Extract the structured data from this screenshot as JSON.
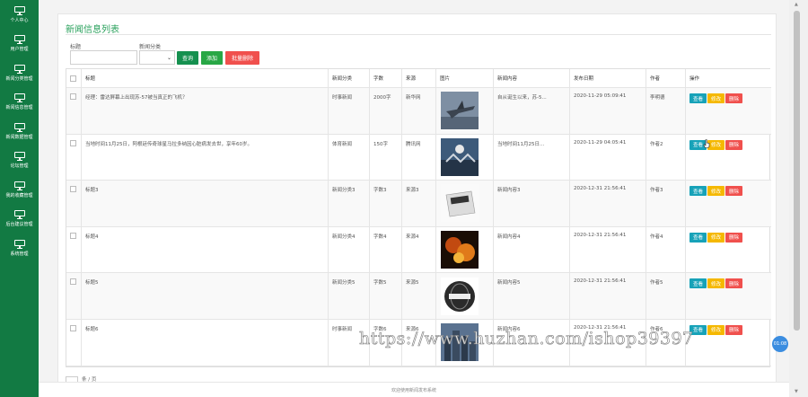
{
  "sidebar": {
    "items": [
      {
        "label": "个人中心",
        "icon": "monitor-icon"
      },
      {
        "label": "用户管理",
        "icon": "monitor-icon"
      },
      {
        "label": "新闻分类管理",
        "icon": "monitor-icon"
      },
      {
        "label": "新闻信息管理",
        "icon": "monitor-icon"
      },
      {
        "label": "新闻数据管理",
        "icon": "monitor-icon"
      },
      {
        "label": "论坛管理",
        "icon": "monitor-icon"
      },
      {
        "label": "我的收藏管理",
        "icon": "monitor-icon"
      },
      {
        "label": "后台建议管理",
        "icon": "monitor-icon"
      },
      {
        "label": "系统管理",
        "icon": "monitor-icon"
      }
    ]
  },
  "panel": {
    "title": "新闻信息列表"
  },
  "filters": {
    "title_label": "标题",
    "title_value": "",
    "category_label": "新闻分类",
    "category_value": "",
    "search_button": "查询",
    "add_button": "添加",
    "batch_delete_button": "批量删除"
  },
  "table": {
    "headers": [
      "",
      "标题",
      "新闻分类",
      "字数",
      "来源",
      "图片",
      "新闻内容",
      "发布日期",
      "作者",
      "操作"
    ],
    "rows": [
      {
        "title": "经理：雷达屏幕上出现苏-57被当真正的飞机？",
        "category": "时事新闻",
        "words": "2000字",
        "source": "新华网",
        "image": "fighter-jet",
        "content": "自从诞生以来，苏-5...",
        "date": "2020-11-29 05:09:41",
        "author": "李明德"
      },
      {
        "title": "当地时间11月25日，阿根廷传奇球星马拉多纳因心脏病发去世，享年60岁。",
        "category": "体育新闻",
        "words": "150字",
        "source": "腾讯网",
        "image": "stadium-crowd",
        "content": "当地时间11月25日...",
        "date": "2020-11-29 04:05:41",
        "author": "作者2"
      },
      {
        "title": "标题3",
        "category": "新闻分类3",
        "words": "字数3",
        "source": "来源3",
        "image": "news-paper",
        "content": "新闻内容3",
        "date": "2020-12-31 21:56:41",
        "author": "作者3"
      },
      {
        "title": "标题4",
        "category": "新闻分类4",
        "words": "字数4",
        "source": "来源4",
        "image": "fire-news",
        "content": "新闻内容4",
        "date": "2020-12-31 21:56:41",
        "author": "作者4"
      },
      {
        "title": "标题5",
        "category": "新闻分类5",
        "words": "字数5",
        "source": "来源5",
        "image": "news-globe",
        "content": "新闻内容5",
        "date": "2020-12-31 21:56:41",
        "author": "作者5"
      },
      {
        "title": "标题6",
        "category": "时事新闻",
        "words": "字数6",
        "source": "来源6",
        "image": "city-skyline",
        "content": "新闻内容6",
        "date": "2020-12-31 21:56:41",
        "author": "作者6"
      }
    ],
    "actions": {
      "view": "查看",
      "edit": "修改",
      "delete": "删除"
    }
  },
  "pager": {
    "text": "条 / 页"
  },
  "footer": {
    "text": "欢迎使用新闻发布系统"
  },
  "watermark": "https://www.huzhan.com/ishop39397",
  "badge": "01:08",
  "colors": {
    "sidebar": "#127a43",
    "accent": "#2aa15c",
    "view": "#17a2b8",
    "edit": "#f5b800",
    "delete": "#f0504d"
  }
}
